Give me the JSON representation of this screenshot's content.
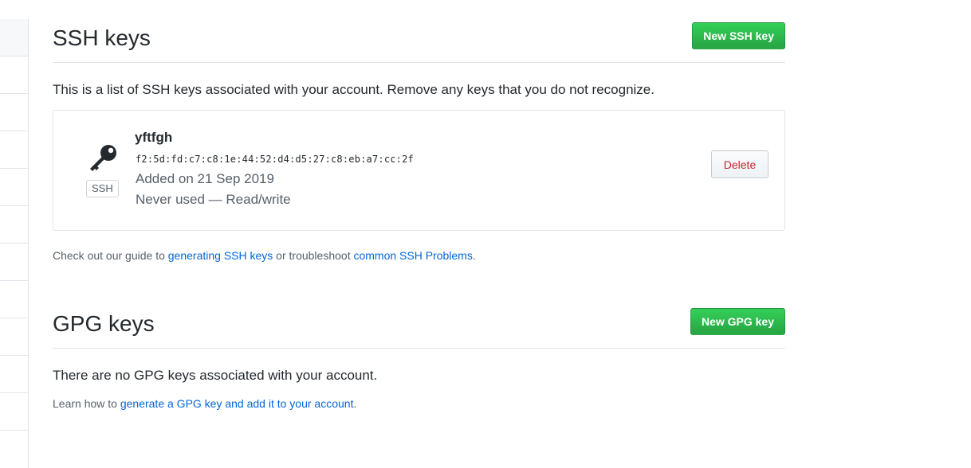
{
  "ssh": {
    "title": "SSH keys",
    "new_button": "New SSH key",
    "description": "This is a list of SSH keys associated with your account. Remove any keys that you do not recognize.",
    "key": {
      "name": "yftfgh",
      "fingerprint": "f2:5d:fd:c7:c8:1e:44:52:d4:d5:27:c8:eb:a7:cc:2f",
      "added": "Added on 21 Sep 2019",
      "usage": "Never used — Read/write",
      "badge": "SSH",
      "icon": "key-icon",
      "delete_button": "Delete"
    },
    "guide": {
      "prefix": "Check out our guide to ",
      "link1": "generating SSH keys",
      "middle": " or troubleshoot ",
      "link2": "common SSH Problems",
      "suffix": "."
    }
  },
  "gpg": {
    "title": "GPG keys",
    "new_button": "New GPG key",
    "empty_text": "There are no GPG keys associated with your account.",
    "learn": {
      "prefix": "Learn how to ",
      "link": "generate a GPG key and add it to your account",
      "suffix": "."
    }
  },
  "colors": {
    "primary_button": "#28a745",
    "link": "#0366d6",
    "danger": "#cb2431",
    "border": "#e1e4e8"
  }
}
